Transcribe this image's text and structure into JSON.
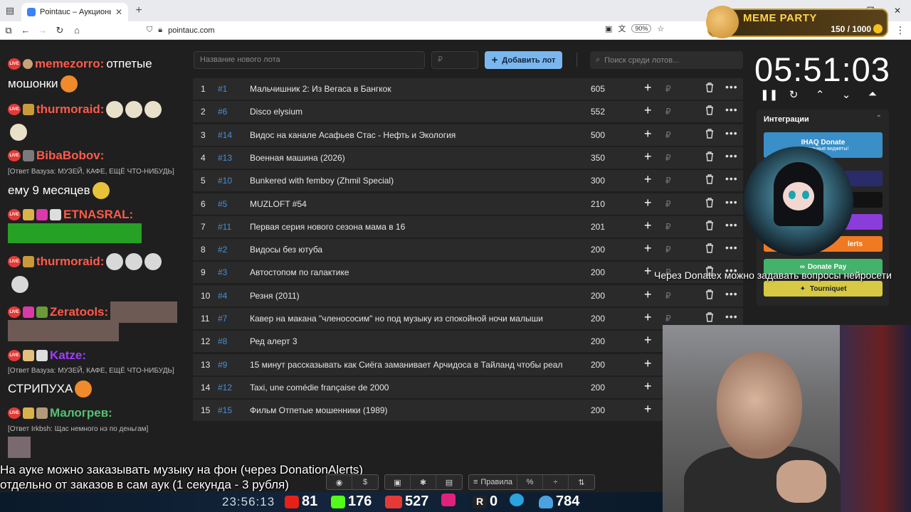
{
  "browser": {
    "tab_title": "Pointauc – Аукционы, лотереи",
    "url": "pointauc.com",
    "zoom": "90%"
  },
  "meme_party": {
    "title": "MEME PARTY",
    "counter": "150 / 1000"
  },
  "chat": {
    "messages": [
      {
        "nick": "memezorro:",
        "text": "отпетые",
        "nick_color": "#ff5a4a"
      },
      {
        "cont": "мошонки"
      },
      {
        "nick": "thurmoraid:",
        "nick_color": "#ff5a4a"
      },
      {
        "nick": "BibaBobov:",
        "nick_color": "#ff5a4a"
      },
      {
        "reply": "[Ответ Вазуза: МУЗЕЙ, КАФЕ, ЕЩЁ ЧТО-НИБУДЬ]"
      },
      {
        "text": "ему 9 месяцев"
      },
      {
        "nick": "ЕTNASRAL:",
        "nick_color": "#ff5a4a"
      },
      {
        "nick": "thurmoraid:",
        "nick_color": "#ff5a4a"
      },
      {
        "nick": "Zeratools:",
        "nick_color": "#ff5a4a"
      },
      {
        "nick": "Katze:",
        "nick_color": "#a33cff"
      },
      {
        "reply": "[Ответ Вазуза: МУЗЕЙ, КАФЕ, ЕЩЁ ЧТО-НИБУДЬ]"
      },
      {
        "text": "СТРИПУХА"
      },
      {
        "nick": "Малогрев:",
        "nick_color": "#56c271"
      },
      {
        "reply": "[Ответ Irkbsh: Щас немного нэ по деньгам]"
      }
    ]
  },
  "auction": {
    "lot_placeholder": "Название нового лота",
    "price_placeholder": "₽",
    "add_button": "Добавить лот",
    "search_placeholder": "Поиск среди лотов...",
    "lots": [
      {
        "n": "1",
        "id": "#1",
        "name": "Мальчишник 2: Из Вегаса в Бангкок",
        "amount": "605"
      },
      {
        "n": "2",
        "id": "#6",
        "name": "Disco elysium",
        "amount": "552"
      },
      {
        "n": "3",
        "id": "#14",
        "name": "Видос на канале Асафьев Стас - Нефть и Экология",
        "amount": "500"
      },
      {
        "n": "4",
        "id": "#13",
        "name": "Военная машина (2026)",
        "amount": "350"
      },
      {
        "n": "5",
        "id": "#10",
        "name": "Bunkered with femboy (Zhmil Special)",
        "amount": "300"
      },
      {
        "n": "6",
        "id": "#5",
        "name": "MUZLOFT #54",
        "amount": "210"
      },
      {
        "n": "7",
        "id": "#11",
        "name": "Первая серия нового сезона мама в 16",
        "amount": "201"
      },
      {
        "n": "8",
        "id": "#2",
        "name": "Видосы без ютуба",
        "amount": "200"
      },
      {
        "n": "9",
        "id": "#3",
        "name": "Автостопом по галактике",
        "amount": "200"
      },
      {
        "n": "10",
        "id": "#4",
        "name": "Резня (2011)",
        "amount": "200"
      },
      {
        "n": "11",
        "id": "#7",
        "name": "Кавер на макана \"членососим\" но под музыку из спокойной ночи малыши",
        "amount": "200"
      },
      {
        "n": "12",
        "id": "#8",
        "name": "Ред алерт 3",
        "amount": "200"
      },
      {
        "n": "13",
        "id": "#9",
        "name": "15 минут рассказывать как Сиёга заманивает Арчидоса в Тайланд чтобы реал",
        "amount": "200"
      },
      {
        "n": "14",
        "id": "#12",
        "name": "Taxi, une comédie française de 2000",
        "amount": "200"
      },
      {
        "n": "15",
        "id": "#15",
        "name": "Фильм Отпетые мошенники (1989)",
        "amount": "200"
      }
    ],
    "currency": "₽"
  },
  "timer": {
    "value": "05:51:03"
  },
  "integrations": {
    "title": "Интеграции",
    "ihaq": "IHAQ Donate",
    "ihaq_sub": "Уникальные виджеты!",
    "da": "lerts",
    "donatepay": "Donate Pay",
    "tourniquet": "Tourniquet",
    "colors": {
      "ihaq": "#3a8fc8",
      "dark_blue": "#2a2c6a",
      "black": "#121212",
      "purple": "#8a3ddb",
      "orange": "#f07a22",
      "green": "#43b26b",
      "yellow": "#d7c943"
    }
  },
  "overlay_text": "Через Donatex можно задавать вопросы нейросети",
  "subtitle": {
    "line1": "На ауке можно заказывать музыку на фон (через DonationAlerts)",
    "line2": "отдельно от заказов в сам аук (1 секунда - 3 рубля)"
  },
  "toolbar": {
    "rules_label": "Правила"
  },
  "stats": {
    "clock": "23:56:13",
    "youtube": "81",
    "kick": "176",
    "vk": "527",
    "rutube": "0",
    "telegram": "",
    "users": "784"
  }
}
